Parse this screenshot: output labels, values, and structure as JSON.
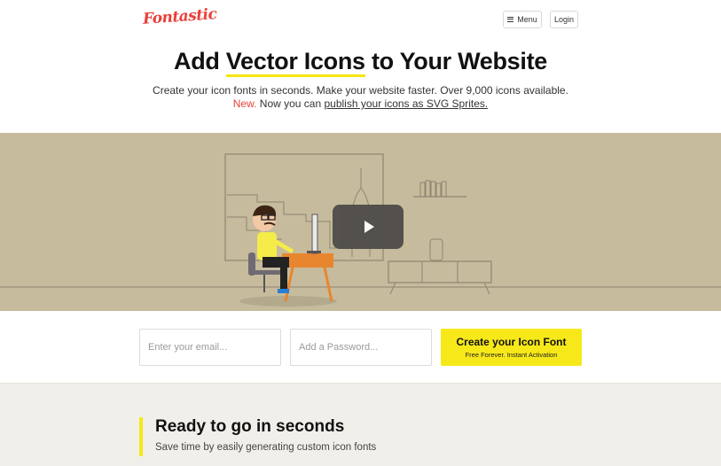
{
  "header": {
    "logo_text": "Fontastic",
    "menu_label": "Menu",
    "login_label": "Login"
  },
  "hero_text": {
    "headline_pre": "Add ",
    "headline_highlight": "Vector Icons",
    "headline_post": " to Your Website",
    "subline": "Create your icon fonts in seconds. Make your website faster. Over 9,000 icons available.",
    "new_label": "New.",
    "subline2_mid": " Now you can ",
    "subline2_link": "publish your icons as SVG Sprites."
  },
  "signup": {
    "email_placeholder": "Enter your email...",
    "password_placeholder": "Add a Password...",
    "cta_title": "Create your Icon Font",
    "cta_subtitle": "Free Forever. Instant Activation"
  },
  "feature": {
    "title": "Ready to go in seconds",
    "subtitle": "Save time by easily generating custom icon fonts"
  },
  "colors": {
    "accent_yellow": "#f7e81a",
    "brand_red": "#e8403a",
    "hero_bg": "#c6bb9c"
  },
  "icons": {
    "menu": "hamburger-icon",
    "play": "play-icon"
  }
}
